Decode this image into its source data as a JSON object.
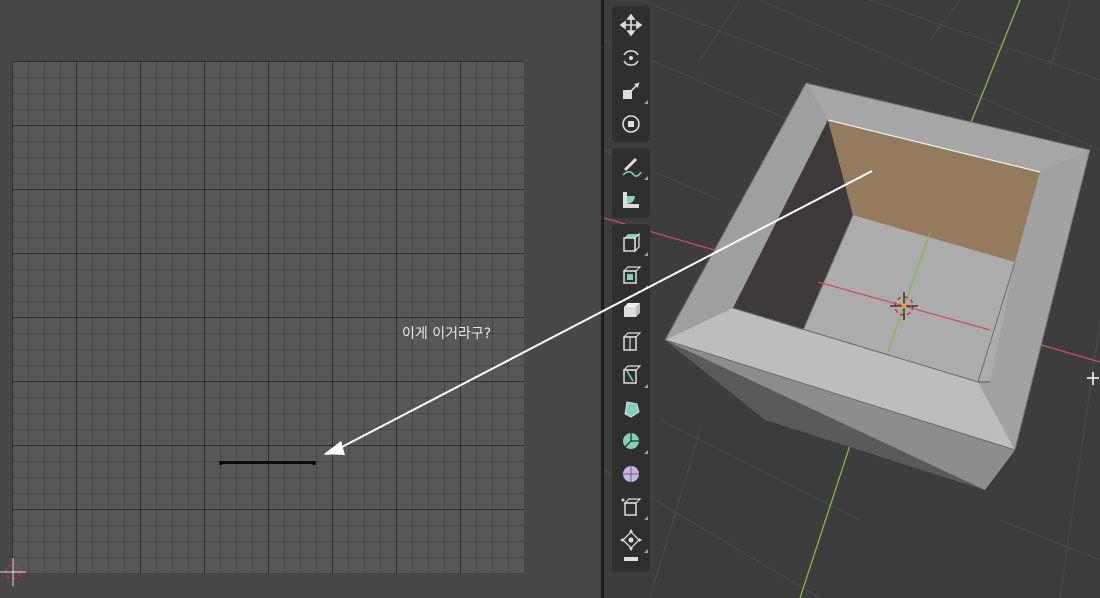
{
  "uv_editor": {
    "annotation": "이게 이거라구?"
  },
  "toolbar": {
    "tools": [
      {
        "name": "move-tool",
        "icon": "move-icon"
      },
      {
        "name": "rotate-tool",
        "icon": "rotate-icon"
      },
      {
        "name": "scale-tool",
        "icon": "scale-icon"
      },
      {
        "name": "transform-tool",
        "icon": "transform-icon"
      },
      {
        "name": "annotate-tool",
        "icon": "annotate-icon"
      },
      {
        "name": "measure-tool",
        "icon": "measure-icon"
      },
      {
        "name": "add-cube-tool",
        "icon": "add-cube-icon"
      },
      {
        "name": "extrude-region-tool",
        "icon": "extrude-icon"
      },
      {
        "name": "inset-faces-tool",
        "icon": "inset-icon"
      },
      {
        "name": "bevel-tool",
        "icon": "bevel-icon"
      },
      {
        "name": "loop-cut-tool",
        "icon": "loop-cut-icon"
      },
      {
        "name": "knife-tool",
        "icon": "knife-icon"
      },
      {
        "name": "poly-build-tool",
        "icon": "poly-build-icon"
      },
      {
        "name": "spin-tool",
        "icon": "spin-icon"
      },
      {
        "name": "smooth-tool",
        "icon": "smooth-icon"
      },
      {
        "name": "edge-slide-tool",
        "icon": "edge-slide-icon"
      },
      {
        "name": "shrink-fatten-tool",
        "icon": "shrink-fatten-icon"
      }
    ]
  },
  "colors": {
    "selected_face": "#957b5e",
    "x_axis": "#c8505a",
    "y_axis": "#8ab544",
    "mesh_light": "#a9a9a9",
    "mesh_mid": "#8d8d8d",
    "mesh_dark": "#3f3a3a"
  }
}
